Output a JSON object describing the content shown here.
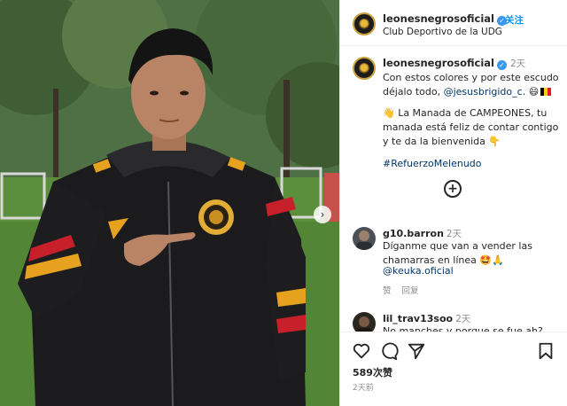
{
  "photo": {
    "next_icon": "chevron-right-icon"
  },
  "header": {
    "username": "leonesnegrosoficial",
    "verified_icon": "verified-badge-icon",
    "follow_label": "关注",
    "subtitle": "Club Deportivo de la UDG"
  },
  "caption": {
    "username": "leonesnegrosoficial",
    "time": "2天",
    "line1_before": "Con estos colores y por este escudo déjalo todo, ",
    "line1_mention": "@jesusbrigido_c",
    "line1_after": ". 😄",
    "para2": "👋 La Manada de CAMPEONES, tu manada está feliz de contar contigo y te da la bienvenida 👇",
    "hashtag": "#RefuerzoMelenudo"
  },
  "load_more_icon": "plus-circle-icon",
  "comments": [
    {
      "username": "g10.barron",
      "time": "2天",
      "text": "Díganme que van a vender las chamarras en línea 🤩🙏",
      "mention": "@keuka.oficial",
      "like_label": "赞",
      "reply_label": "回复"
    },
    {
      "username": "lil_trav13soo",
      "time": "2天",
      "text": "No manches y porque se fue ah?"
    }
  ],
  "actions": {
    "like_icon": "heart-icon",
    "comment_icon": "comment-bubble-icon",
    "share_icon": "paper-plane-icon",
    "save_icon": "bookmark-icon",
    "likes": "589次赞",
    "posted": "2天前"
  },
  "colors": {
    "link": "#00376b",
    "follow": "#0095f6",
    "verified": "#3897f0",
    "muted": "#8e8e8e"
  }
}
